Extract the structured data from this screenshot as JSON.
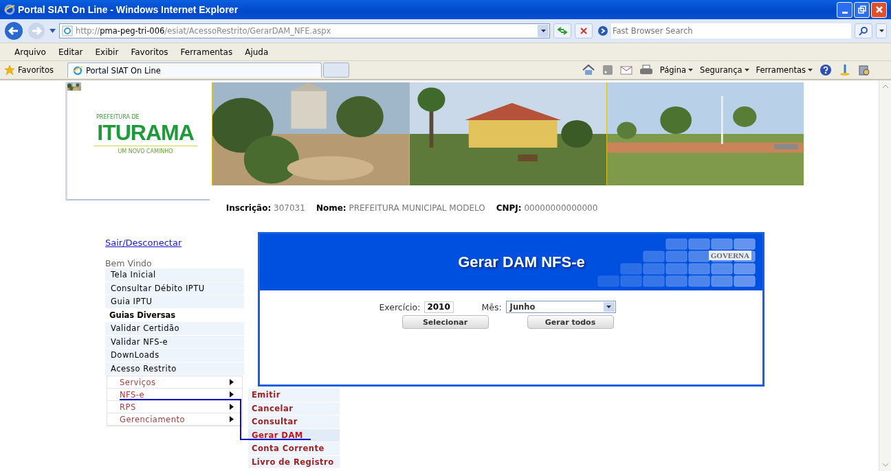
{
  "window": {
    "title": "Portal SIAT On Line - Windows Internet Explorer"
  },
  "address_bar": {
    "scheme": "http://",
    "host": "pma-peg-tri-006",
    "path": "/esiat/AcessoRestrito/GerarDAM_NFE.aspx"
  },
  "search": {
    "placeholder": "Fast Browser Search"
  },
  "menu_bar": [
    "Arquivo",
    "Editar",
    "Exibir",
    "Favoritos",
    "Ferramentas",
    "Ajuda"
  ],
  "favorites_bar": {
    "label": "Favoritos",
    "tabs": [
      {
        "label": "Portal SIAT On Line",
        "selected": true
      }
    ]
  },
  "command_bar": [
    "Página",
    "Segurança",
    "Ferramentas"
  ],
  "logo": {
    "top": "PREFEITURA DE",
    "name": "ITURAMA",
    "tagline": "UM NOVO CAMINHO"
  },
  "info": [
    {
      "label": "Inscrição:",
      "value": "307031"
    },
    {
      "label": "Nome:",
      "value": "PREFEITURA MUNICIPAL MODELO"
    },
    {
      "label": "CNPJ:",
      "value": "00000000000000"
    }
  ],
  "sidebar": {
    "logout": "Sair/Desconectar",
    "welcome": "Bem Vindo",
    "items": [
      {
        "label": "Tela Inicial",
        "selected": false
      },
      {
        "label": "Consultar Débito IPTU",
        "selected": false
      },
      {
        "label": "Guia IPTU",
        "selected": false
      },
      {
        "label": "Guias Diversas",
        "selected": true
      },
      {
        "label": "Validar Certidão",
        "selected": false
      },
      {
        "label": "Validar NFS-e",
        "selected": false
      },
      {
        "label": "DownLoads",
        "selected": false
      },
      {
        "label": "Acesso Restrito",
        "selected": false
      }
    ],
    "submenu": [
      {
        "label": "Serviços",
        "expanded": false
      },
      {
        "label": "NFS-e",
        "expanded": true
      },
      {
        "label": "RPS",
        "expanded": false
      },
      {
        "label": "Gerenciamento",
        "expanded": false
      }
    ],
    "flyout": [
      {
        "label": "Emitir",
        "selected": false
      },
      {
        "label": "Cancelar",
        "selected": false
      },
      {
        "label": "Consultar",
        "selected": false
      },
      {
        "label": "Gerar DAM",
        "selected": true
      },
      {
        "label": "Conta Corrente",
        "selected": false
      },
      {
        "label": "Livro de Registro",
        "selected": false
      }
    ]
  },
  "panel": {
    "title": "Gerar DAM NFS-e",
    "brand": "GOVERNA",
    "year": {
      "label": "Exercício:",
      "value": "2010"
    },
    "month": {
      "label": "Mês:",
      "value": "Junho"
    },
    "buttons": [
      "Selecionar",
      "Gerar todos"
    ]
  }
}
